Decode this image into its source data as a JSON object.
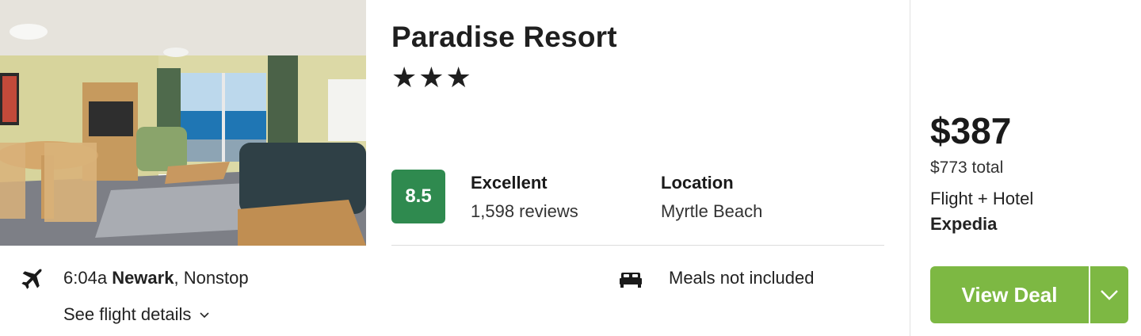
{
  "hotel": {
    "name": "Paradise Resort",
    "stars": "★★★",
    "score": "8.5",
    "rating_label": "Excellent",
    "review_count": "1,598 reviews",
    "location_label": "Location",
    "location_value": "Myrtle Beach"
  },
  "flight": {
    "time": "6:04a",
    "airport": "Newark",
    "stops": ", Nonstop",
    "details_link": "See flight details"
  },
  "amenities": {
    "meals": "Meals not included"
  },
  "pricing": {
    "price": "$387",
    "total": "$773 total",
    "package": "Flight + Hotel",
    "provider": "Expedia",
    "cta_label": "View Deal"
  },
  "icons": {
    "flight": "airplane-icon",
    "meals": "bed-icon",
    "details": "chevron-down-icon",
    "deal_dropdown": "chevron-down-icon"
  },
  "colors": {
    "score_badge": "#2f8a4f",
    "cta": "#7db843"
  }
}
